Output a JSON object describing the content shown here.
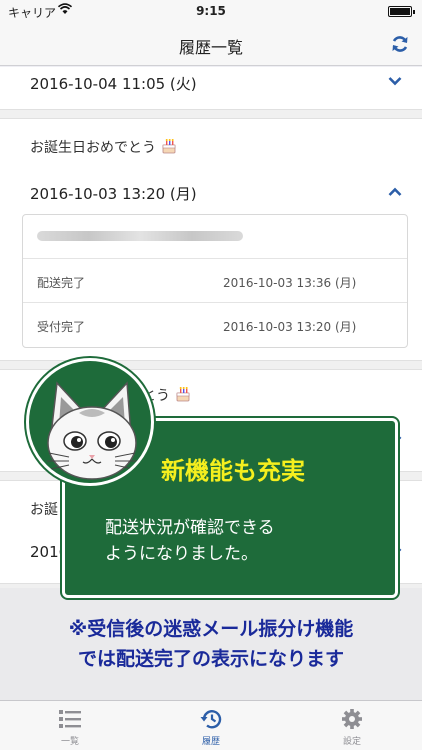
{
  "status": {
    "carrier": "キャリア",
    "time": "9:15"
  },
  "header": {
    "title": "履歴一覧"
  },
  "entries": [
    {
      "date": "2016-10-04 11:05 (火)"
    },
    {
      "subject": "お誕生日おめでとう",
      "date": "2016-10-03 13:20 (月)",
      "details": [
        {
          "label": "配送完了",
          "value": "2016-10-03 13:36 (月)"
        },
        {
          "label": "受付完了",
          "value": "2016-10-03 13:20 (月)"
        }
      ]
    },
    {
      "subject_partial": "とう"
    },
    {
      "subject_partial": "お誕",
      "date_partial": "2016"
    }
  ],
  "overlay": {
    "title": "新機能も充実",
    "body_line1": "配送状況が確認できる",
    "body_line2": "ようになりました。"
  },
  "promo": {
    "line1": "※受信後の迷惑メール振分け機能",
    "line2": "では配送完了の表示になります"
  },
  "tabs": [
    {
      "label": "一覧"
    },
    {
      "label": "履歴"
    },
    {
      "label": "設定"
    }
  ],
  "colors": {
    "accent": "#2c5ea8",
    "board": "#1e6b3a",
    "board_title": "#f5ef1e",
    "promo": "#1a2a9a"
  }
}
